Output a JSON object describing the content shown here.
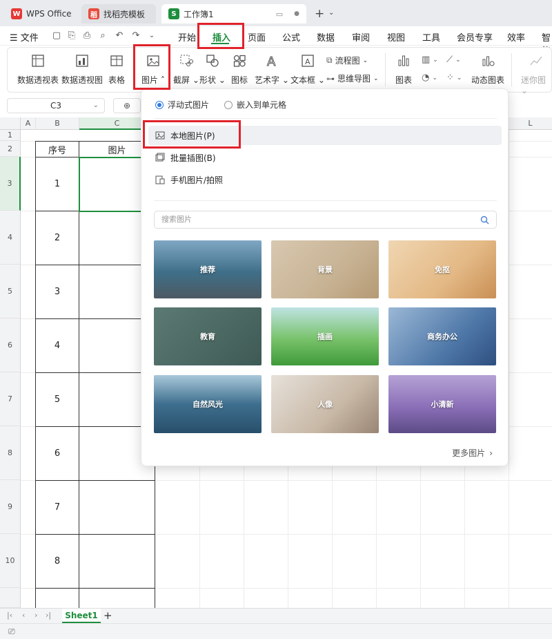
{
  "tabs": [
    {
      "label": "WPS Office",
      "icon": "wps-logo-icon"
    },
    {
      "label": "找稻壳模板",
      "icon": "docer-icon"
    },
    {
      "label": "工作簿1",
      "icon": "spreadsheet-icon",
      "active": true
    }
  ],
  "menu": {
    "file": "文件",
    "items": [
      "开始",
      "插入",
      "页面",
      "公式",
      "数据",
      "审阅",
      "视图",
      "工具",
      "会员专享",
      "效率",
      "智能"
    ],
    "active": "插入"
  },
  "ribbon": {
    "pivot_table": "数据透视表",
    "pivot_chart": "数据透视图",
    "table": "表格",
    "picture": "图片",
    "screenshot": "截屏",
    "shape": "形状",
    "icon": "图标",
    "wordart": "艺术字",
    "textbox": "文本框",
    "flowchart": "流程图",
    "mindmap": "思维导图",
    "chart": "图表",
    "dynamic_chart": "动态图表",
    "sparkline": "迷你图"
  },
  "formula": {
    "cell_ref": "C3"
  },
  "grid": {
    "columns": [
      "A",
      "B",
      "C",
      "L"
    ],
    "rows": [
      "1",
      "2",
      "3",
      "4",
      "5",
      "6",
      "7",
      "8",
      "9",
      "10"
    ],
    "header_seq": "序号",
    "header_pic": "图片",
    "seq_values": [
      "1",
      "2",
      "3",
      "4",
      "5",
      "6",
      "7",
      "8"
    ]
  },
  "dropdown": {
    "radio_float": "浮动式图片",
    "radio_embed": "嵌入到单元格",
    "local_picture": "本地图片(P)",
    "batch_insert": "批量插图(B)",
    "phone_picture": "手机图片/拍照",
    "search_placeholder": "搜索图片",
    "categories": [
      "推荐",
      "背景",
      "免抠",
      "教育",
      "插画",
      "商务办公",
      "自然风光",
      "人像",
      "小清新"
    ],
    "more": "更多图片"
  },
  "sheet": {
    "name": "Sheet1"
  },
  "colors": {
    "accent_green": "#1e8e3e",
    "highlight_red": "#e0222b",
    "radio_blue": "#2f7ae5"
  }
}
